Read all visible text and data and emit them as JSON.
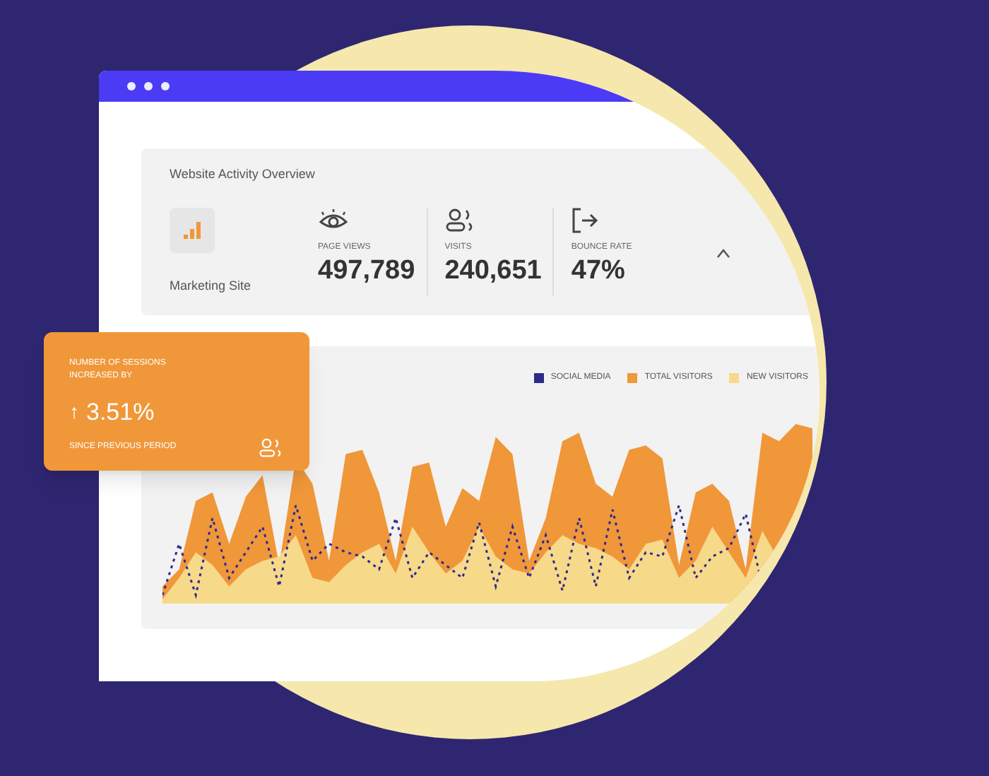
{
  "overview": {
    "title": "Website Activity Overview",
    "site": "Marketing Site",
    "stats": [
      {
        "label": "PAGE VIEWS",
        "value": "497,789",
        "kind": "eye"
      },
      {
        "label": "VISITS",
        "value": "240,651",
        "kind": "users"
      },
      {
        "label": "BOUNCE RATE",
        "value": "47%",
        "kind": "exit"
      }
    ]
  },
  "sessions_card": {
    "title": "NUMBER OF SESSIONS INCREASED BY",
    "arrow": "↑",
    "value": "3.51%",
    "note": "SINCE PREVIOUS PERIOD"
  },
  "legend": [
    {
      "label": "SOCIAL MEDIA",
      "color": "#2e2a8c"
    },
    {
      "label": "TOTAL VISITORS",
      "color": "#f0973a"
    },
    {
      "label": "NEW VISITORS",
      "color": "#f7d98a"
    }
  ]
}
